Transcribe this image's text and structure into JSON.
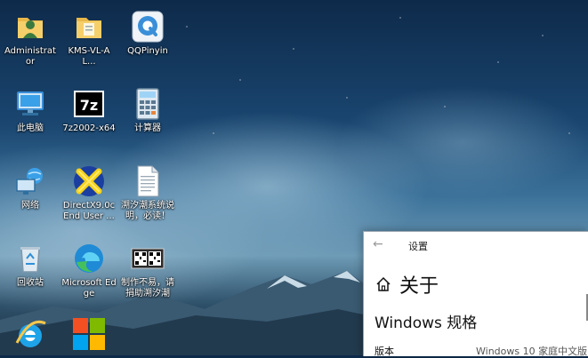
{
  "desktop": {
    "icons": [
      {
        "label": "Administrator",
        "icon": "user-folder-icon"
      },
      {
        "label": "KMS-VL-AL...",
        "icon": "folder-icon"
      },
      {
        "label": "QQPinyin",
        "icon": "qqpinyin-icon"
      },
      {
        "label": "此电脑",
        "icon": "computer-icon"
      },
      {
        "label": "7z2002-x64",
        "icon": "7zip-icon"
      },
      {
        "label": "计算器",
        "icon": "calculator-icon"
      },
      {
        "label": "网络",
        "icon": "network-icon"
      },
      {
        "label": "DirectX9.0c End User ...",
        "icon": "directx-icon"
      },
      {
        "label": "溯汐潮系统说明，必读！",
        "icon": "text-document-icon"
      },
      {
        "label": "回收站",
        "icon": "recycle-bin-icon"
      },
      {
        "label": "Microsoft Edge",
        "icon": "edge-icon"
      },
      {
        "label": "制作不易，请捐助溯汐潮",
        "icon": "qr-code-image-icon"
      },
      {
        "label": "",
        "icon": "internet-explorer-icon"
      },
      {
        "label": "",
        "icon": "windows-logo-icon"
      }
    ]
  },
  "settings": {
    "window_title": "设置",
    "back_glyph": "←",
    "page_title": "关于",
    "section_title": "Windows 规格",
    "spec_label": "版本",
    "spec_value": "Windows 10 家庭中文版"
  },
  "colors": {
    "accent": "#0078d7",
    "qq_blue": "#3a8fd8",
    "edge_blue": "#1f8bd6",
    "edge_green": "#45c05c",
    "ie_blue": "#1fa3e8"
  }
}
